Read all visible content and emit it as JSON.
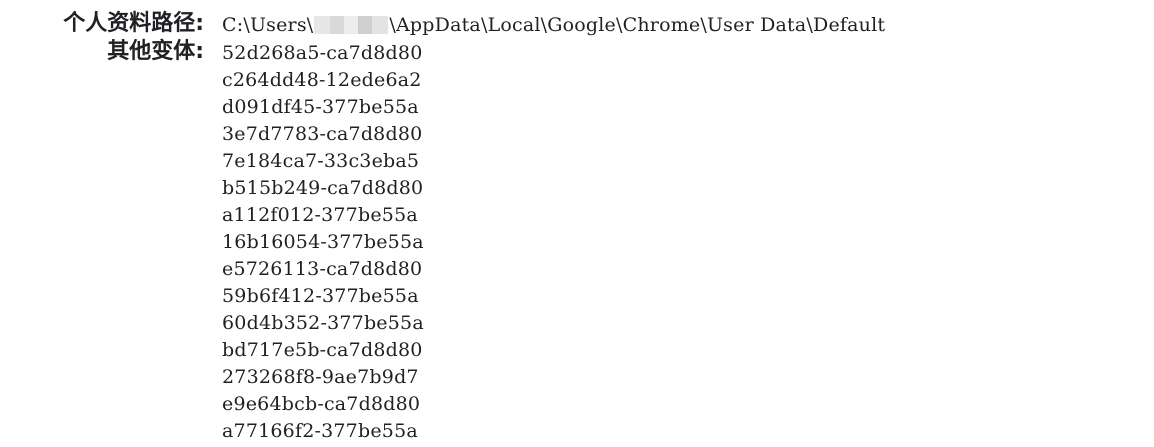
{
  "profile_path": {
    "label": "个人资料路径:",
    "prefix": "C:\\Users\\",
    "redacted_segment": "",
    "suffix": "\\AppData\\Local\\Google\\Chrome\\User Data\\Default"
  },
  "variants": {
    "label": "其他变体:",
    "items": [
      "52d268a5-ca7d8d80",
      "c264dd48-12ede6a2",
      "d091df45-377be55a",
      "3e7d7783-ca7d8d80",
      "7e184ca7-33c3eba5",
      "b515b249-ca7d8d80",
      "a112f012-377be55a",
      "16b16054-377be55a",
      "e5726113-ca7d8d80",
      "59b6f412-377be55a",
      "60d4b352-377be55a",
      "bd717e5b-ca7d8d80",
      "273268f8-9ae7b9d7",
      "e9e64bcb-ca7d8d80",
      "a77166f2-377be55a"
    ]
  }
}
